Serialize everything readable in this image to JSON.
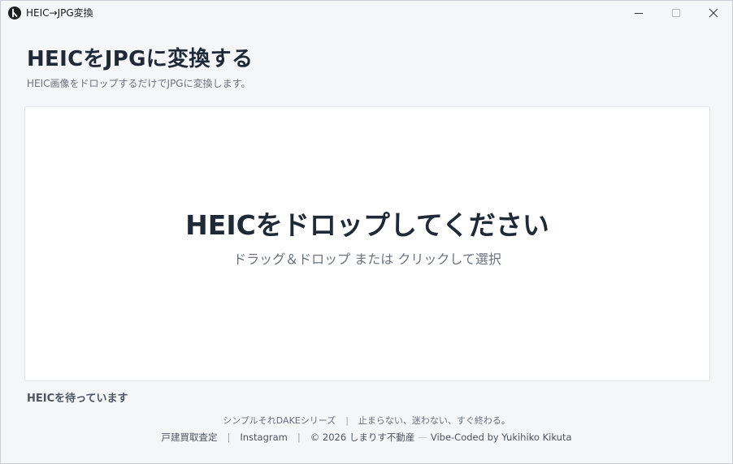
{
  "window": {
    "title": "HEIC→JPG変換",
    "icon": "app-logo-icon",
    "controls": {
      "minimize_icon": "minimize-icon",
      "maximize_icon": "maximize-icon",
      "close_icon": "close-icon"
    }
  },
  "header": {
    "title": "HEICをJPGに変換する",
    "subtitle": "HEIC画像をドロップするだけでJPGに変換します。"
  },
  "dropzone": {
    "title": "HEICをドロップしてください",
    "hint": "ドラッグ＆ドロップ または クリックして選択"
  },
  "status": {
    "text": "HEICを待っています"
  },
  "footer": {
    "series_name": "シンプルそれDAKEシリーズ",
    "separator": "|",
    "tagline": "止まらない、迷わない、すぐ終わる。",
    "links": {
      "appraisal": "戸建買取査定",
      "instagram": "Instagram"
    },
    "copyright": "© 2026 しまりす不動産",
    "dash": "—",
    "credit": "Vibe-Coded by Yukihiko Kikuta"
  },
  "colors": {
    "window_bg": "#f5f6f8",
    "dropzone_bg": "#ffffff",
    "text_primary": "#1f2937",
    "text_secondary": "#6b7280"
  }
}
